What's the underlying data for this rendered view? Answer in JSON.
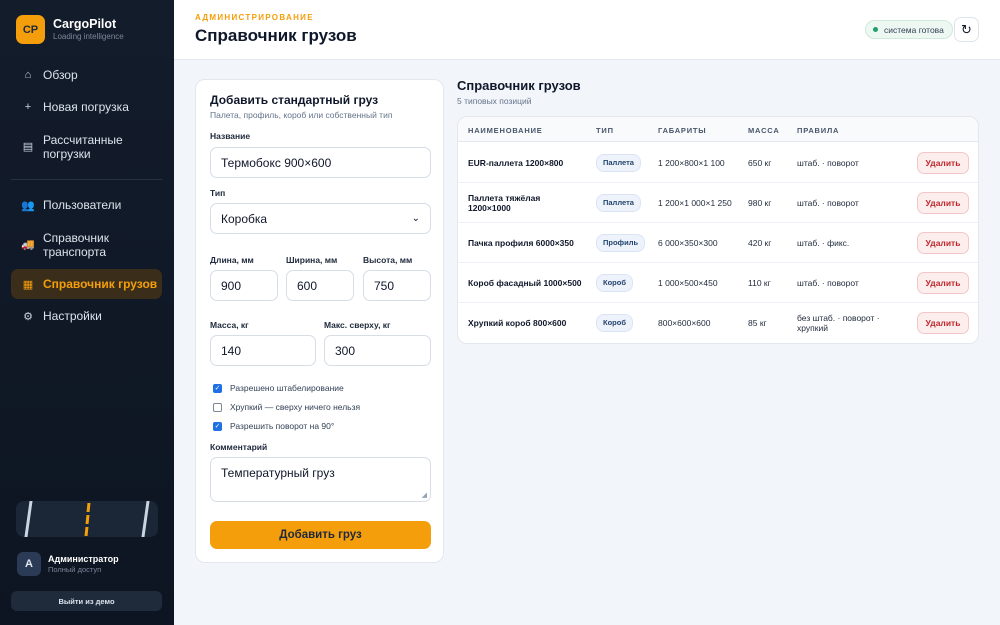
{
  "app": {
    "logo": "CP",
    "name": "CargoPilot",
    "tagline": "Loading intelligence"
  },
  "sidebar": {
    "items": [
      {
        "label": "Обзор",
        "icon": "home-icon",
        "glyph": "⌂"
      },
      {
        "label": "Новая погрузка",
        "icon": "plus-icon",
        "glyph": "+"
      },
      {
        "label": "Рассчитанные погрузки",
        "icon": "list-icon",
        "glyph": "▤"
      },
      {
        "label": "Пользователи",
        "icon": "users-icon",
        "glyph": "👥"
      },
      {
        "label": "Справочник транспорта",
        "icon": "truck-icon",
        "glyph": "🚚"
      },
      {
        "label": "Справочник грузов",
        "icon": "box-icon",
        "glyph": "▦",
        "active": true
      },
      {
        "label": "Настройки",
        "icon": "gear-icon",
        "glyph": "⚙"
      }
    ]
  },
  "user": {
    "initial": "A",
    "name": "Администратор",
    "role": "Полный доступ",
    "logout_label": "Выйти из демо"
  },
  "header": {
    "eyebrow": "АДМИНИСТРИРОВАНИЕ",
    "title": "Справочник грузов",
    "status": "система готова",
    "refresh_glyph": "↻"
  },
  "form": {
    "title": "Добавить стандартный груз",
    "subtitle": "Палета, профиль, короб или собственный тип",
    "name_label": "Название",
    "name_value": "Термобокс 900×600",
    "type_label": "Тип",
    "type_value": "Коробка",
    "length_label": "Длина, мм",
    "length_value": "900",
    "width_label": "Ширина, мм",
    "width_value": "600",
    "height_label": "Высота, мм",
    "height_value": "750",
    "mass_label": "Масса, кг",
    "mass_value": "140",
    "maxtop_label": "Макс. сверху, кг",
    "maxtop_value": "300",
    "checkboxes": [
      {
        "label": "Разрешено штабелирование",
        "checked": true
      },
      {
        "label": "Хрупкий — сверху ничего нельзя",
        "checked": false
      },
      {
        "label": "Разрешить поворот на 90°",
        "checked": true
      }
    ],
    "comment_label": "Комментарий",
    "comment_value": "Температурный груз",
    "submit_label": "Добавить груз"
  },
  "list": {
    "title": "Справочник грузов",
    "subtitle": "5 типовых позиций",
    "columns": {
      "name": "НАИМЕНОВАНИЕ",
      "type": "ТИП",
      "dims": "ГАБАРИТЫ",
      "mass": "МАССА",
      "rules": "ПРАВИЛА"
    },
    "delete_label": "Удалить",
    "rows": [
      {
        "name": "EUR-паллета 1200×800",
        "type": "Паллета",
        "dims": "1 200×800×1 100",
        "mass": "650 кг",
        "rules": "штаб. · поворот"
      },
      {
        "name": "Паллета тяжёлая 1200×1000",
        "type": "Паллета",
        "dims": "1 200×1 000×1 250",
        "mass": "980 кг",
        "rules": "штаб. · поворот"
      },
      {
        "name": "Пачка профиля 6000×350",
        "type": "Профиль",
        "dims": "6 000×350×300",
        "mass": "420 кг",
        "rules": "штаб. · фикс."
      },
      {
        "name": "Короб фасадный 1000×500",
        "type": "Короб",
        "dims": "1 000×500×450",
        "mass": "110 кг",
        "rules": "штаб. · поворот"
      },
      {
        "name": "Хрупкий короб 800×600",
        "type": "Короб",
        "dims": "800×600×600",
        "mass": "85 кг",
        "rules": "без штаб. · поворот · хрупкий"
      }
    ]
  }
}
